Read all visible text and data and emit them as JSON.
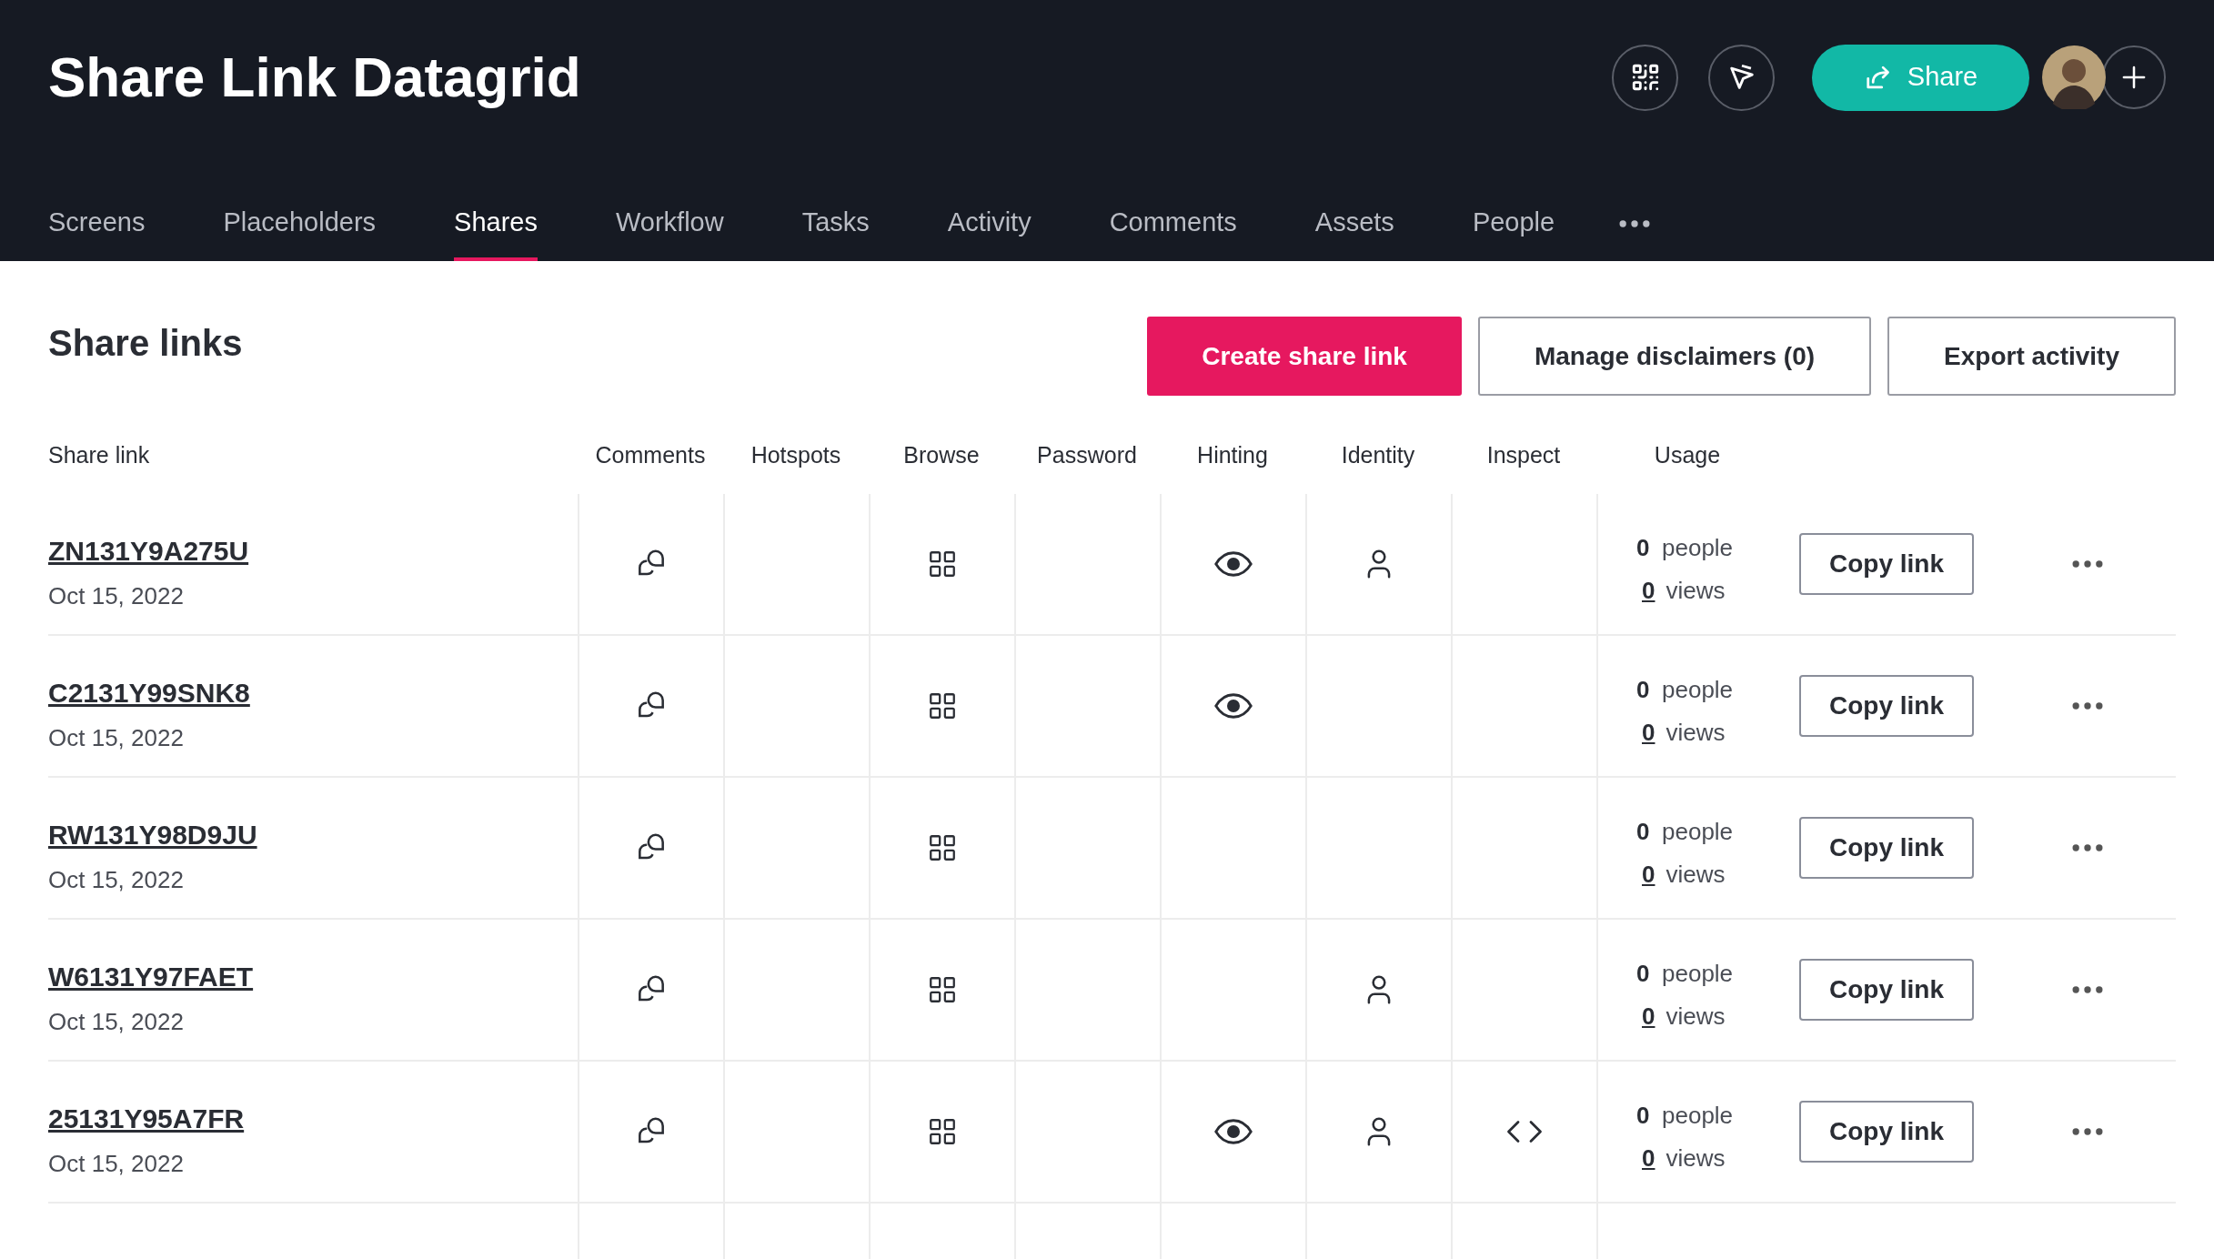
{
  "header": {
    "title": "Share Link Datagrid",
    "share_button": "Share"
  },
  "tabs": [
    {
      "label": "Screens",
      "selected": false
    },
    {
      "label": "Placeholders",
      "selected": false
    },
    {
      "label": "Shares",
      "selected": true
    },
    {
      "label": "Workflow",
      "selected": false
    },
    {
      "label": "Tasks",
      "selected": false
    },
    {
      "label": "Activity",
      "selected": false
    },
    {
      "label": "Comments",
      "selected": false
    },
    {
      "label": "Assets",
      "selected": false
    },
    {
      "label": "People",
      "selected": false
    }
  ],
  "section": {
    "title": "Share links",
    "buttons": [
      {
        "label": "Create share link",
        "kind": "primary"
      },
      {
        "label": "Manage disclaimers (0)",
        "kind": "outline"
      },
      {
        "label": "Export activity",
        "kind": "outline"
      }
    ]
  },
  "table": {
    "columns": [
      {
        "label": "Share link",
        "kind": "link"
      },
      {
        "label": "Comments",
        "kind": "comments"
      },
      {
        "label": "Hotspots",
        "kind": "hotspots"
      },
      {
        "label": "Browse",
        "kind": "browse"
      },
      {
        "label": "Password",
        "kind": "password"
      },
      {
        "label": "Hinting",
        "kind": "hinting"
      },
      {
        "label": "Identity",
        "kind": "identity"
      },
      {
        "label": "Inspect",
        "kind": "inspect"
      },
      {
        "label": "Usage",
        "kind": "usage"
      }
    ],
    "rows": [
      {
        "name": "ZN131Y9A275U",
        "date": "Oct 15, 2022",
        "flags": {
          "comments": true,
          "browse": true,
          "hinting": true,
          "identity": true,
          "inspect": false
        },
        "people": "0",
        "people_label": "people",
        "views": "0",
        "views_label": "views",
        "copy": "Copy link"
      },
      {
        "name": "C2131Y99SNK8",
        "date": "Oct 15, 2022",
        "flags": {
          "comments": true,
          "browse": true,
          "hinting": true,
          "identity": false,
          "inspect": false
        },
        "people": "0",
        "people_label": "people",
        "views": "0",
        "views_label": "views",
        "copy": "Copy link"
      },
      {
        "name": "RW131Y98D9JU",
        "date": "Oct 15, 2022",
        "flags": {
          "comments": true,
          "browse": true,
          "hinting": false,
          "identity": false,
          "inspect": false
        },
        "people": "0",
        "people_label": "people",
        "views": "0",
        "views_label": "views",
        "copy": "Copy link"
      },
      {
        "name": "W6131Y97FAET",
        "date": "Oct 15, 2022",
        "flags": {
          "comments": true,
          "browse": true,
          "hinting": false,
          "identity": true,
          "inspect": false
        },
        "people": "0",
        "people_label": "people",
        "views": "0",
        "views_label": "views",
        "copy": "Copy link"
      },
      {
        "name": "25131Y95A7FR",
        "date": "Oct 15, 2022",
        "flags": {
          "comments": true,
          "browse": true,
          "hinting": true,
          "identity": true,
          "inspect": true
        },
        "people": "0",
        "people_label": "people",
        "views": "0",
        "views_label": "views",
        "copy": "Copy link"
      }
    ]
  }
}
